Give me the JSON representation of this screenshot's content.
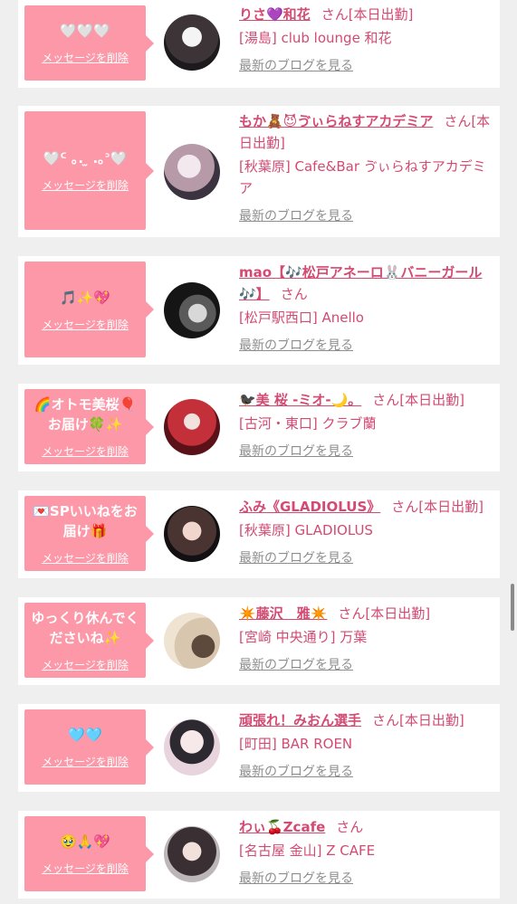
{
  "cards": [
    {
      "message": "🤍🤍🤍",
      "delete_label": "メッセージを削除",
      "name": "りさ💜和花",
      "suffix": "さん[本日出勤]",
      "shop": "[湯島] club lounge 和花",
      "blog_label": "最新のブログを見る"
    },
    {
      "message": "🤍ᑦ ｡. ̫ .｡ᐣ🤍",
      "delete_label": "メッセージを削除",
      "name": "もか🧸😈ゔぃらねすアカデミア",
      "suffix": "さん[本日出勤]",
      "shop": "[秋葉原] Cafe&Bar ゔぃらねすアカデミア",
      "blog_label": "最新のブログを見る"
    },
    {
      "message": "🎵✨💖",
      "delete_label": "メッセージを削除",
      "name": "mao【🎶松戸アネーロ🐰バニーガール🎶】",
      "suffix": "さん",
      "shop": "[松戸駅西口] Anello",
      "blog_label": "最新のブログを見る"
    },
    {
      "message": "🌈オトモ美桜🎈お届け🍀✨",
      "delete_label": "メッセージを削除",
      "name": "🐦‍⬛美 桜 -ミオ-🌙。",
      "suffix": "さん[本日出勤]",
      "shop": "[古河・東口] クラブ蘭",
      "blog_label": "最新のブログを見る"
    },
    {
      "message": "💌SPいいねをお届け🎁",
      "delete_label": "メッセージを削除",
      "name": "ふみ《GLADIOLUS》",
      "suffix": "さん[本日出勤]",
      "shop": "[秋葉原] GLADIOLUS",
      "blog_label": "最新のブログを見る"
    },
    {
      "message": "ゆっくり休んでくださいね✨",
      "delete_label": "メッセージを削除",
      "name": "✴️藤沢　雅✴️",
      "suffix": "さん[本日出勤]",
      "shop": "[宮崎 中央通り] 万葉",
      "blog_label": "最新のブログを見る"
    },
    {
      "message": "🩵🩵",
      "delete_label": "メッセージを削除",
      "name": "頑張れ！みおん選手",
      "suffix": "さん[本日出勤]",
      "shop": "[町田] BAR ROEN",
      "blog_label": "最新のブログを見る"
    },
    {
      "message": "🥹🙏💖",
      "delete_label": "メッセージを削除",
      "name": "わぃ🍒Zcafe",
      "suffix": "さん",
      "shop": "[名古屋 金山] Z CAFE",
      "blog_label": "最新のブログを見る"
    }
  ],
  "colors": {
    "bubble": "#fc98a8",
    "name": "#d34a72",
    "blog_link": "#8e8e8e",
    "background": "#efefef"
  }
}
